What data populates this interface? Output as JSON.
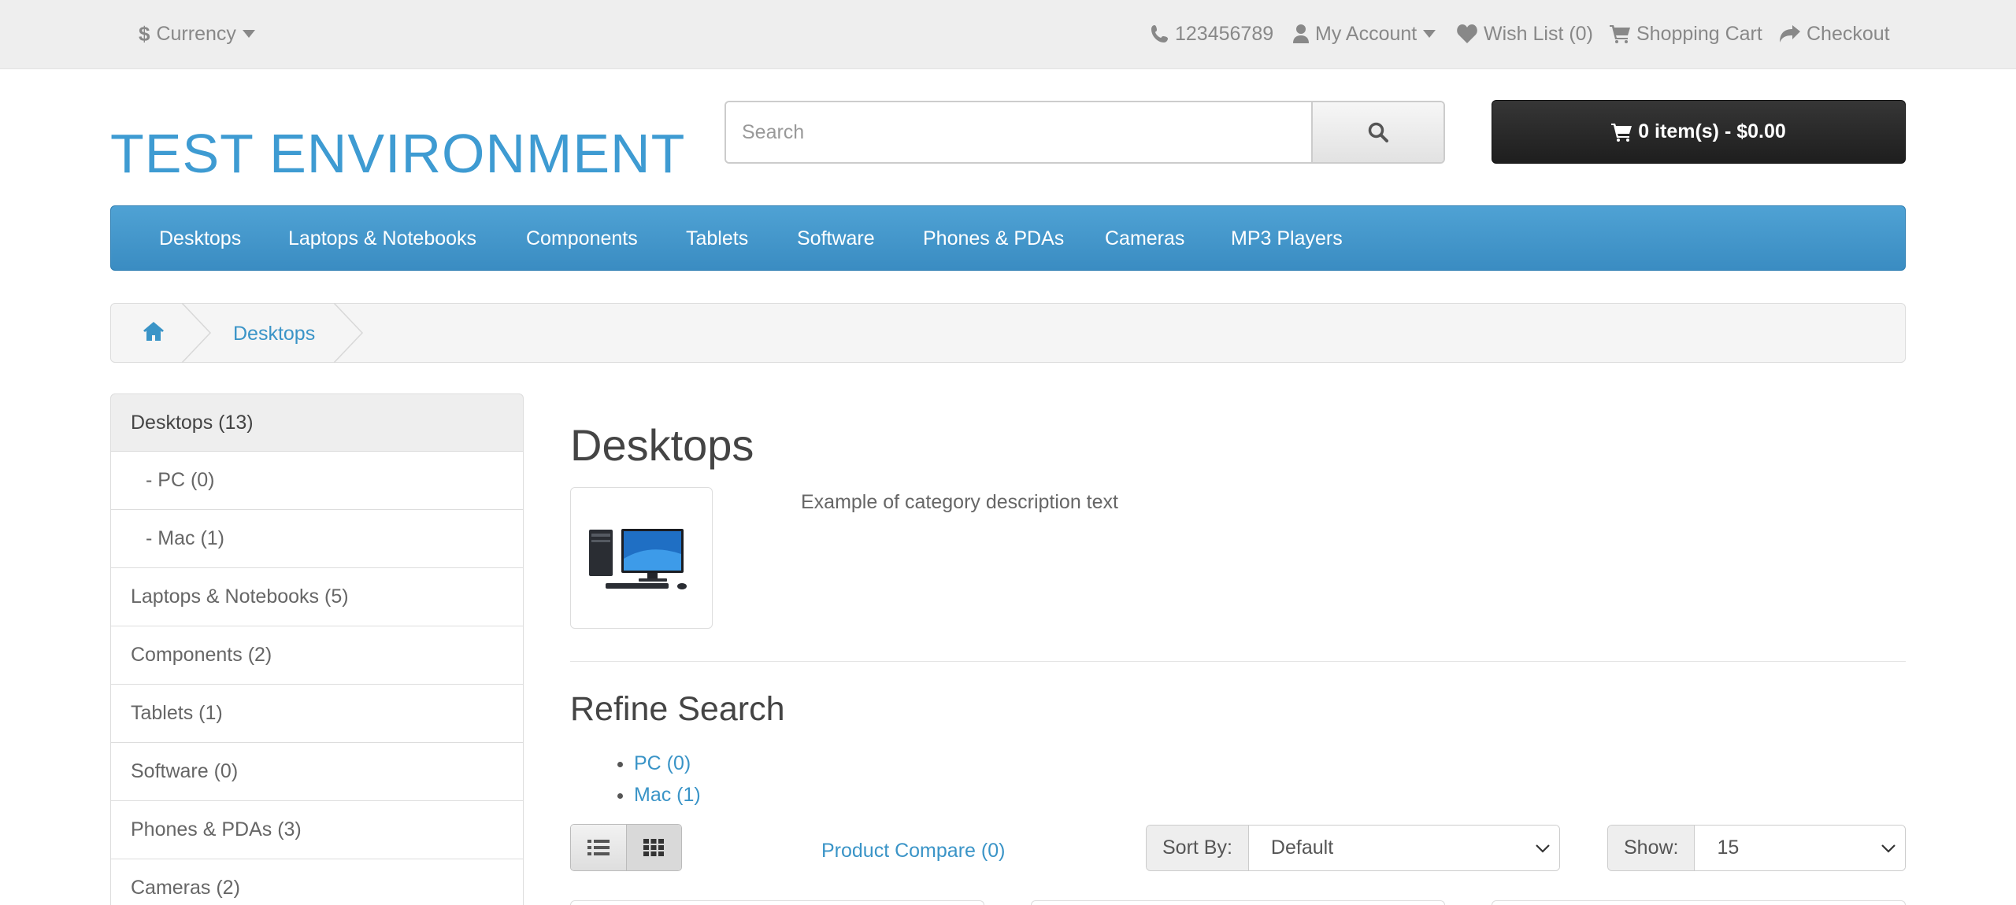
{
  "topbar": {
    "currency": "Currency",
    "phone": "123456789",
    "my_account": "My Account",
    "wishlist": "Wish List (0)",
    "shopping_cart": "Shopping Cart",
    "checkout": "Checkout"
  },
  "header": {
    "logo": "TEST ENVIRONMENT",
    "search_placeholder": "Search",
    "cart": "0 item(s) - $0.00"
  },
  "menu": [
    "Desktops",
    "Laptops & Notebooks",
    "Components",
    "Tablets",
    "Software",
    "Phones & PDAs",
    "Cameras",
    "MP3 Players"
  ],
  "breadcrumb": {
    "current": "Desktops"
  },
  "sidebar": [
    "Desktops (13)",
    "- PC (0)",
    "- Mac (1)",
    "Laptops & Notebooks (5)",
    "Components (2)",
    "Tablets (1)",
    "Software (0)",
    "Phones & PDAs (3)",
    "Cameras (2)"
  ],
  "main": {
    "title": "Desktops",
    "description": "Example of category description text",
    "refine_title": "Refine Search",
    "refine_links": [
      "PC (0)",
      "Mac (1)"
    ],
    "compare": "Product Compare (0)",
    "sort_label": "Sort By:",
    "sort_value": "Default",
    "show_label": "Show:",
    "show_value": "15"
  },
  "colors": {
    "accent": "#3e9bd2",
    "cart_bg": "#222222"
  }
}
